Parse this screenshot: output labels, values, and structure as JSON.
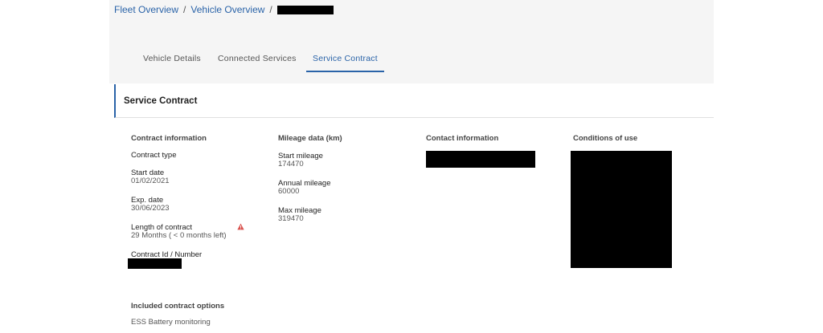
{
  "breadcrumb": {
    "items": [
      "Fleet Overview",
      "Vehicle Overview"
    ],
    "separator": "/"
  },
  "tabs": [
    {
      "label": "Vehicle Details"
    },
    {
      "label": "Connected Services"
    },
    {
      "label": "Service Contract",
      "active": true
    }
  ],
  "section": {
    "title": "Service Contract"
  },
  "contract": {
    "heading": "Contract information",
    "type_label": "Contract type",
    "start_label": "Start date",
    "start_value": "01/02/2021",
    "exp_label": "Exp. date",
    "exp_value": "30/06/2023",
    "length_label": "Length of contract",
    "length_value": "29 Months ( < 0 months left)",
    "id_label": "Contract Id / Number"
  },
  "mileage": {
    "heading": "Mileage data (km)",
    "start_label": "Start mileage",
    "start_value": "174470",
    "annual_label": "Annual mileage",
    "annual_value": "60000",
    "max_label": "Max mileage",
    "max_value": "319470"
  },
  "contact": {
    "heading": "Contact information"
  },
  "conditions": {
    "heading": "Conditions of use"
  },
  "options": {
    "title": "Included contract options",
    "items": [
      "ESS Battery monitoring"
    ]
  },
  "colors": {
    "accent": "#2a63a8",
    "warning": "#d9534f"
  },
  "icons": {
    "warning": "warning-triangle-icon"
  }
}
